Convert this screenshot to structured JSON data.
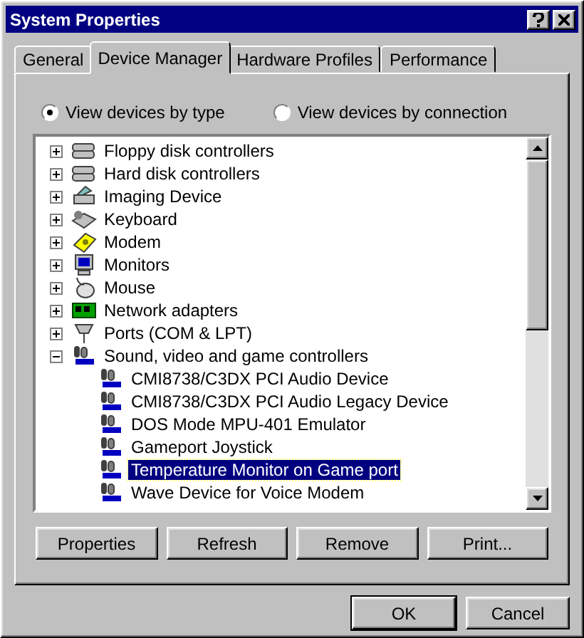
{
  "window": {
    "title": "System Properties"
  },
  "tabs": [
    {
      "label": "General",
      "selected": false
    },
    {
      "label": "Device Manager",
      "selected": true
    },
    {
      "label": "Hardware Profiles",
      "selected": false
    },
    {
      "label": "Performance",
      "selected": false
    }
  ],
  "view_options": [
    {
      "label": "View devices by type",
      "selected": true
    },
    {
      "label": "View devices by connection",
      "selected": false
    }
  ],
  "tree": [
    {
      "label": "Floppy disk controllers",
      "kind": "drive",
      "expanded": false
    },
    {
      "label": "Hard disk controllers",
      "kind": "drive",
      "expanded": false
    },
    {
      "label": "Imaging Device",
      "kind": "scanner",
      "expanded": false
    },
    {
      "label": "Keyboard",
      "kind": "keyboard",
      "expanded": false
    },
    {
      "label": "Modem",
      "kind": "phone",
      "expanded": false
    },
    {
      "label": "Monitors",
      "kind": "monitor",
      "expanded": false
    },
    {
      "label": "Mouse",
      "kind": "mouse",
      "expanded": false
    },
    {
      "label": "Network adapters",
      "kind": "network",
      "expanded": false
    },
    {
      "label": "Ports (COM & LPT)",
      "kind": "port",
      "expanded": false
    },
    {
      "label": "Sound, video and game controllers",
      "kind": "sound",
      "expanded": true,
      "children": [
        {
          "label": "CMI8738/C3DX PCI Audio Device",
          "kind": "sound",
          "selected": false
        },
        {
          "label": "CMI8738/C3DX PCI Audio Legacy Device",
          "kind": "sound",
          "selected": false
        },
        {
          "label": "DOS Mode MPU-401 Emulator",
          "kind": "sound",
          "selected": false
        },
        {
          "label": "Gameport Joystick",
          "kind": "sound",
          "selected": false
        },
        {
          "label": "Temperature Monitor on Game port",
          "kind": "sound",
          "selected": true
        },
        {
          "label": "Wave Device for Voice Modem",
          "kind": "sound",
          "selected": false
        }
      ]
    }
  ],
  "actions": [
    "Properties",
    "Refresh",
    "Remove",
    "Print..."
  ],
  "dialog_buttons": [
    {
      "label": "OK",
      "default": true
    },
    {
      "label": "Cancel",
      "default": false
    }
  ]
}
